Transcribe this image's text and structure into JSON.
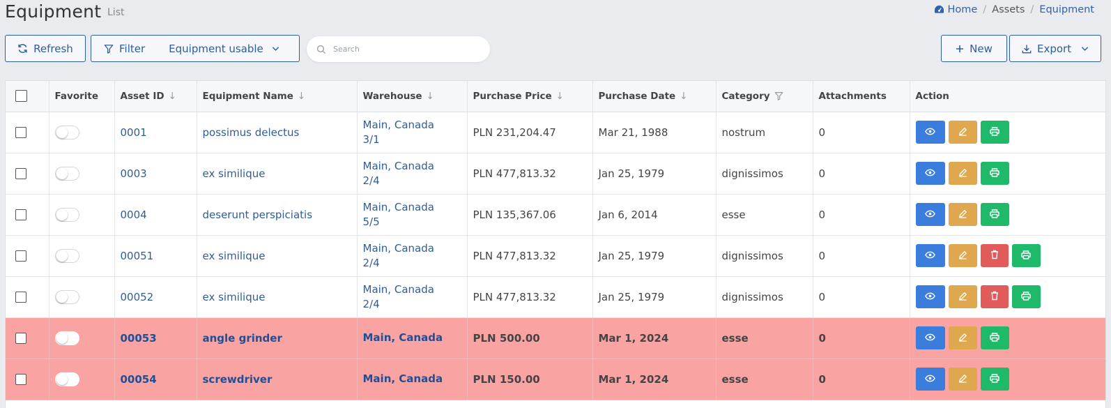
{
  "header": {
    "title": "Equipment",
    "subtitle": "List",
    "breadcrumb": {
      "home": "Home",
      "section": "Assets",
      "current": "Equipment"
    }
  },
  "toolbar": {
    "refresh_label": "Refresh",
    "filter_label": "Filter",
    "filter_value": "Equipment usable",
    "search_placeholder": "Search",
    "new_label": "New",
    "export_label": "Export"
  },
  "table": {
    "columns": {
      "favorite": "Favorite",
      "asset_id": "Asset ID",
      "name": "Equipment Name",
      "warehouse": "Warehouse",
      "price": "Purchase Price",
      "date": "Purchase Date",
      "category": "Category",
      "attachments": "Attachments",
      "action": "Action"
    },
    "rows": [
      {
        "id": "0001",
        "name": "possimus delectus",
        "warehouse": "Main, Canada",
        "location": "3/1",
        "price": "PLN 231,204.47",
        "date": "Mar 21, 1988",
        "category": "nostrum",
        "attachments": "0"
      },
      {
        "id": "0003",
        "name": "ex similique",
        "warehouse": "Main, Canada",
        "location": "2/4",
        "price": "PLN 477,813.32",
        "date": "Jan 25, 1979",
        "category": "dignissimos",
        "attachments": "0"
      },
      {
        "id": "0004",
        "name": "deserunt perspiciatis",
        "warehouse": "Main, Canada",
        "location": "5/5",
        "price": "PLN 135,367.06",
        "date": "Jan 6, 2014",
        "category": "esse",
        "attachments": "0"
      },
      {
        "id": "00051",
        "name": "ex similique",
        "warehouse": "Main, Canada",
        "location": "2/4",
        "price": "PLN 477,813.32",
        "date": "Jan 25, 1979",
        "category": "dignissimos",
        "attachments": "0"
      },
      {
        "id": "00052",
        "name": "ex similique",
        "warehouse": "Main, Canada",
        "location": "2/4",
        "price": "PLN 477,813.32",
        "date": "Jan 25, 1979",
        "category": "dignissimos",
        "attachments": "0"
      },
      {
        "id": "00053",
        "name": "angle grinder",
        "warehouse": "Main, Canada",
        "location": "",
        "price": "PLN 500.00",
        "date": "Mar 1, 2024",
        "category": "esse",
        "attachments": "0"
      },
      {
        "id": "00054",
        "name": "screwdriver",
        "warehouse": "Main, Canada",
        "location": "",
        "price": "PLN 150.00",
        "date": "Mar 1, 2024",
        "category": "esse",
        "attachments": "0"
      }
    ]
  },
  "colors": {
    "link": "#2f5d98",
    "view": "#3b7ddd",
    "edit": "#e0a84e",
    "delete": "#e15b5b",
    "print": "#1fb96a",
    "highlight_row": "#f9a3a3"
  }
}
